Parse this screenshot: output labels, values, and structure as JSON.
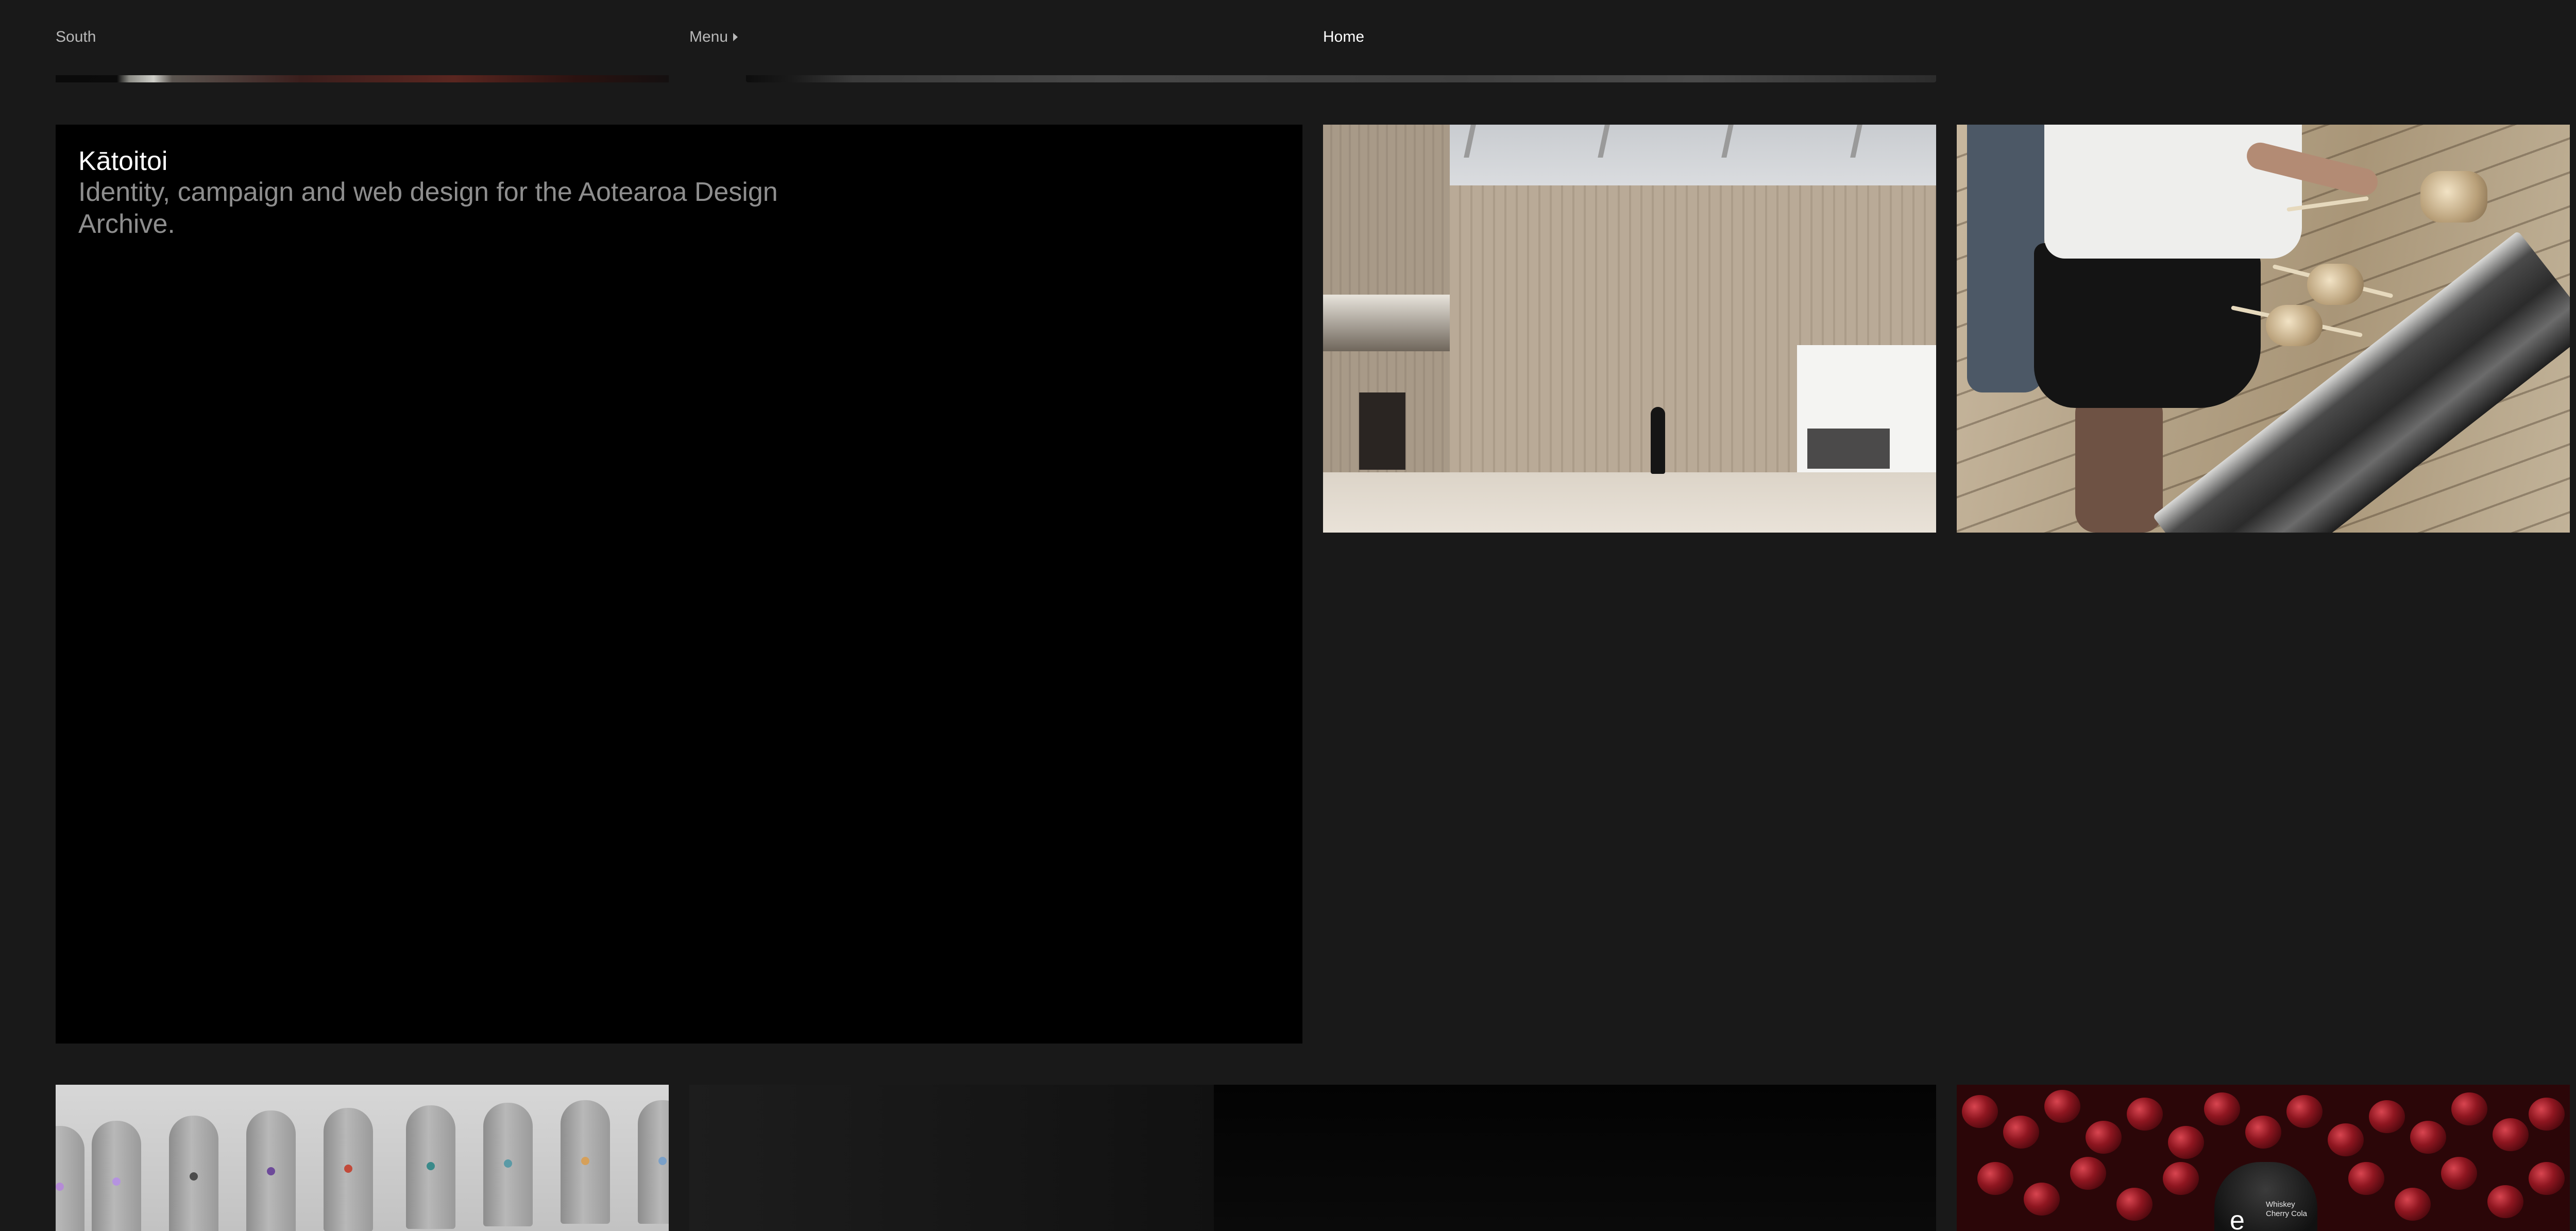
{
  "header": {
    "brand": "South",
    "menu_label": "Menu",
    "home_label": "Home"
  },
  "feature": {
    "title": "Kātoitoi",
    "description": "Identity, campaign and web design for the Aotearoa Design Archive."
  },
  "cherries_tile": {
    "jar_logo": "e",
    "jar_text_line1": "Whiskey",
    "jar_text_line2": "Cherry Cola"
  },
  "colors": {
    "background": "#191919",
    "feature_background": "#000000",
    "text_primary": "#ffffff",
    "text_secondary": "#8e8e8e",
    "nav_text": "#b9b9b9"
  },
  "icons": {
    "menu_caret": "caret-right-icon"
  }
}
